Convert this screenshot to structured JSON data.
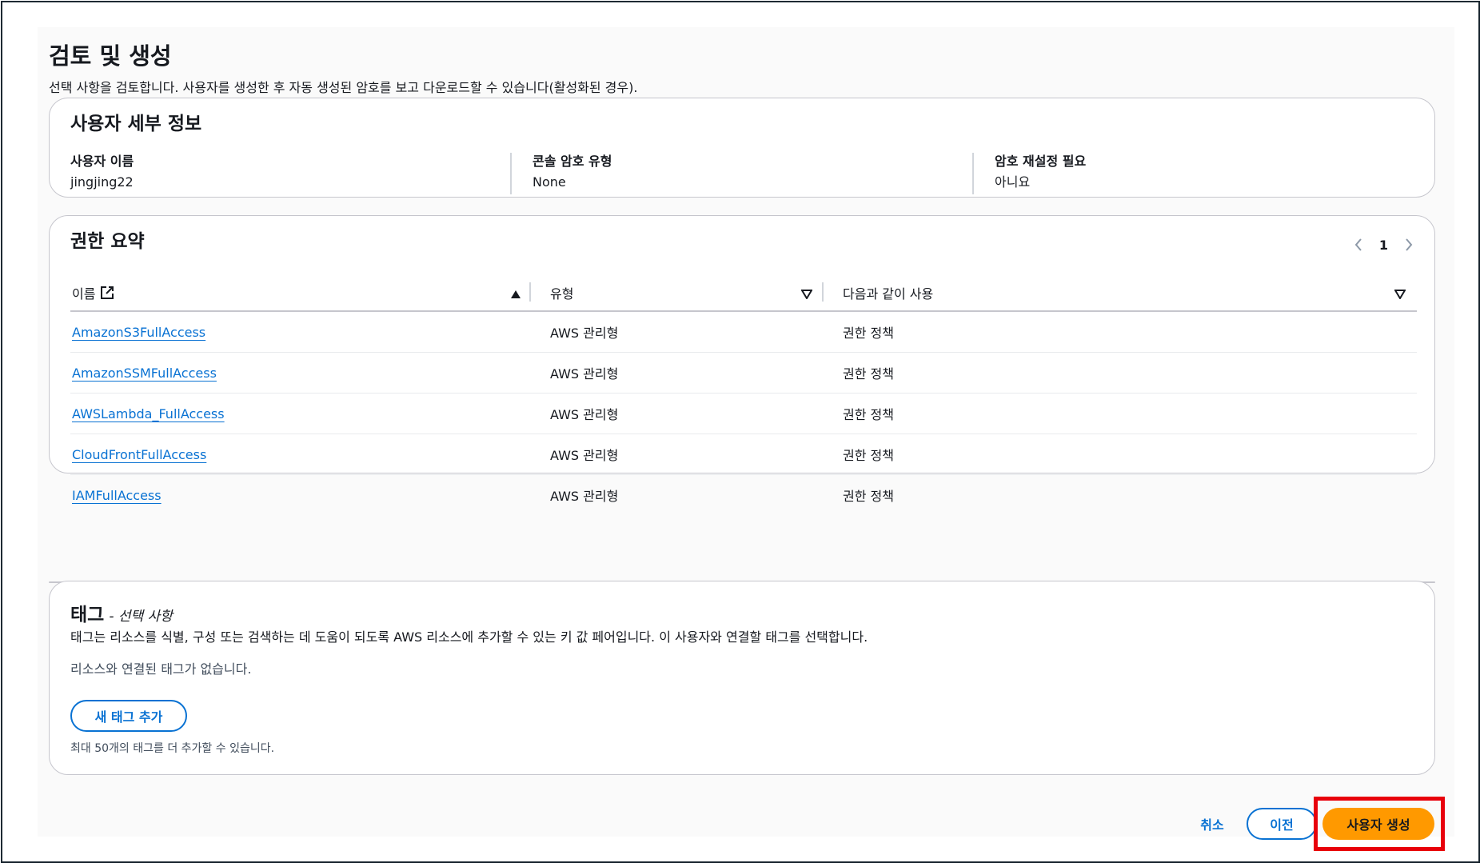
{
  "page": {
    "title": "검토 및 생성",
    "description": "선택 사항을 검토합니다. 사용자를 생성한 후 자동 생성된 암호를 보고 다운로드할 수 있습니다(활성화된 경우)."
  },
  "user_details": {
    "title": "사용자 세부 정보",
    "fields": [
      {
        "label": "사용자 이름",
        "value": "jingjing22"
      },
      {
        "label": "콘솔 암호 유형",
        "value": "None"
      },
      {
        "label": "암호 재설정 필요",
        "value": "아니요"
      }
    ]
  },
  "permissions": {
    "title": "권한 요약",
    "page": "1",
    "columns": [
      "이름",
      "유형",
      "다음과 같이 사용"
    ],
    "rows": [
      {
        "name": "AmazonS3FullAccess",
        "type": "AWS 관리형",
        "usage": "권한 정책"
      },
      {
        "name": "AmazonSSMFullAccess",
        "type": "AWS 관리형",
        "usage": "권한 정책"
      },
      {
        "name": "AWSLambda_FullAccess",
        "type": "AWS 관리형",
        "usage": "권한 정책"
      },
      {
        "name": "CloudFrontFullAccess",
        "type": "AWS 관리형",
        "usage": "권한 정책"
      },
      {
        "name": "IAMFullAccess",
        "type": "AWS 관리형",
        "usage": "권한 정책"
      }
    ]
  },
  "tags": {
    "title": "태그",
    "optional": "- 선택 사항",
    "description": "태그는 리소스를 식별, 구성 또는 검색하는 데 도움이 되도록 AWS 리소스에 추가할 수 있는 키 값 페어입니다. 이 사용자와 연결할 태그를 선택합니다.",
    "empty": "리소스와 연결된 태그가 없습니다.",
    "add_button": "새 태그 추가",
    "limit": "최대 50개의 태그를 더 추가할 수 있습니다."
  },
  "footer": {
    "cancel": "취소",
    "previous": "이전",
    "create": "사용자 생성"
  },
  "colors": {
    "link": "#0972d3",
    "primary_button": "#ff9900",
    "highlight": "#e8000b"
  }
}
